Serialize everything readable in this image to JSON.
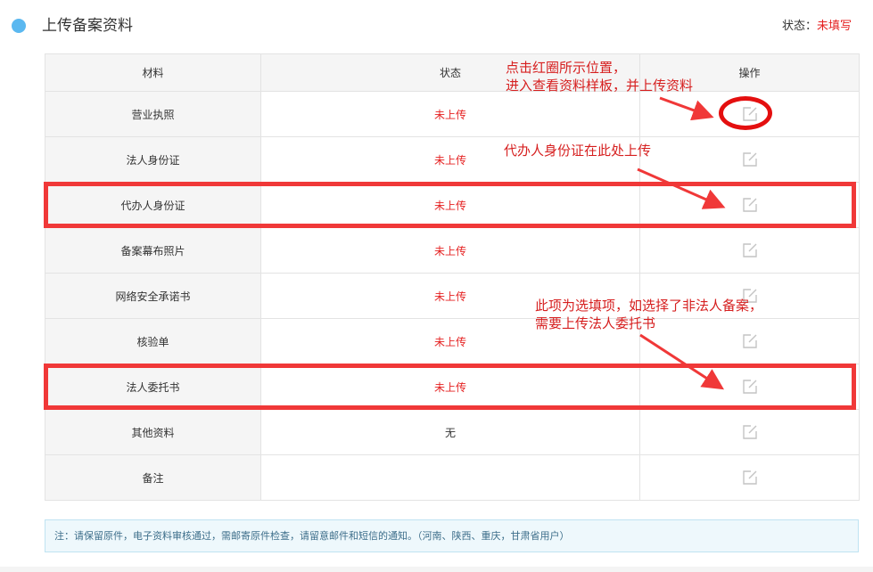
{
  "header": {
    "title": "上传备案资料",
    "status_label": "状态：",
    "status_value": "未填写"
  },
  "table": {
    "columns": [
      "材料",
      "状态",
      "操作"
    ],
    "rows": [
      {
        "material": "营业执照",
        "status": "未上传"
      },
      {
        "material": "法人身份证",
        "status": "未上传"
      },
      {
        "material": "代办人身份证",
        "status": "未上传"
      },
      {
        "material": "备案幕布照片",
        "status": "未上传"
      },
      {
        "material": "网络安全承诺书",
        "status": "未上传"
      },
      {
        "material": "核验单",
        "status": "未上传"
      },
      {
        "material": "法人委托书",
        "status": "未上传"
      },
      {
        "material": "其他资料",
        "status": "无"
      },
      {
        "material": "备注",
        "status": ""
      }
    ],
    "action_icon": "edit-icon"
  },
  "note": "注：请保留原件，电子资料审核通过，需邮寄原件检查，请留意邮件和短信的通知。（河南、陕西、重庆，甘肃省用户）",
  "annotations": {
    "a1_line1": "点击红圈所示位置，",
    "a1_line2": "进入查看资料样板，并上传资料",
    "a2": "代办人身份证在此处上传",
    "a3_line1": "此项为选填项，如选择了非法人备案，",
    "a3_line2": "需要上传法人委托书"
  },
  "colors": {
    "accent_dot": "#5bb8f0",
    "status_red": "#e52222",
    "annotation_red": "#f03838"
  }
}
